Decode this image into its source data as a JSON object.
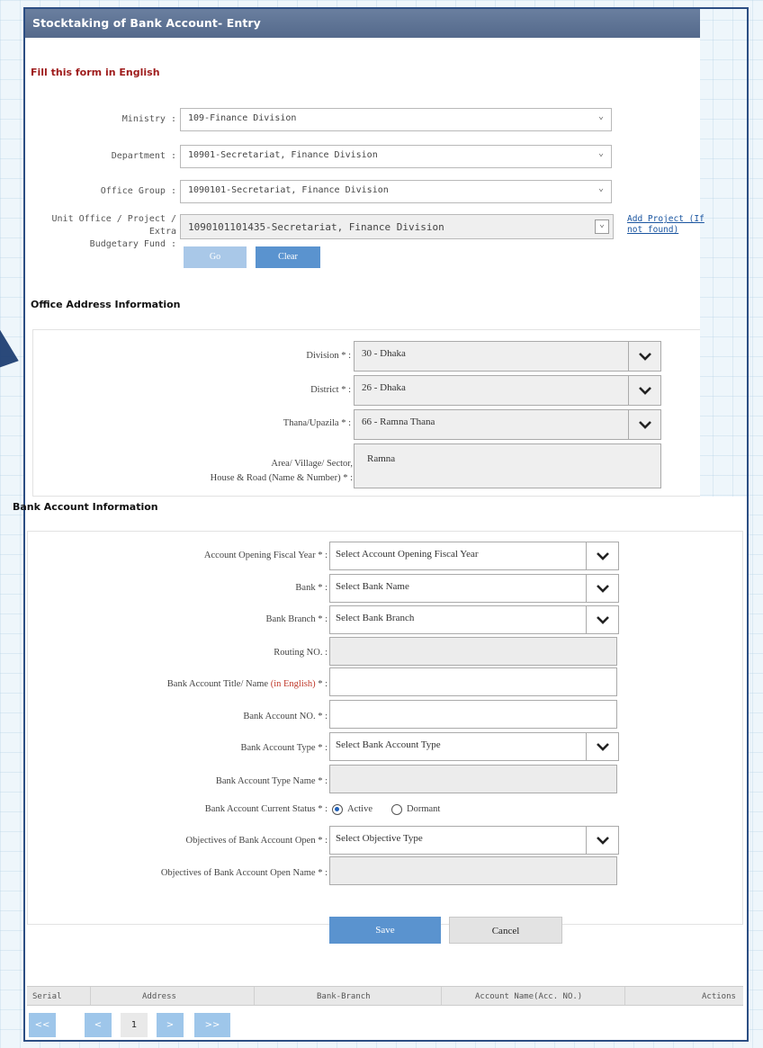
{
  "window": {
    "title": "Stocktaking of Bank Account- Entry",
    "fill_note": "Fill this form in English"
  },
  "office_search": {
    "ministry": {
      "label": "Ministry :",
      "value": "109-Finance Division"
    },
    "department": {
      "label": "Department :",
      "value": "10901-Secretariat, Finance Division"
    },
    "office_group": {
      "label": "Office Group :",
      "value": "1090101-Secretariat, Finance Division"
    },
    "unit_office": {
      "label_line1": "Unit Office / Project / Extra",
      "label_line2": "Budgetary Fund :",
      "value": "1090101101435-Secretariat, Finance Division"
    },
    "add_project_line1": "Add Project (If",
    "add_project_line2": "not found)",
    "go_label": "Go",
    "clear_label": "Clear"
  },
  "office_address": {
    "heading": "Office Address Information",
    "division": {
      "label": "Division * :",
      "value": "30 - Dhaka"
    },
    "district": {
      "label": "District * :",
      "value": "26 - Dhaka"
    },
    "thana": {
      "label": "Thana/Upazila * :",
      "value": "66 - Ramna Thana"
    },
    "area": {
      "label_line1": "Area/ Village/ Sector,",
      "label_line2": "House & Road (Name & Number) * :",
      "value": "Ramna"
    }
  },
  "bank_account": {
    "heading": "Bank Account Information",
    "fiscal_year": {
      "label": "Account Opening Fiscal Year * :",
      "value": "Select Account Opening Fiscal Year"
    },
    "bank": {
      "label": "Bank * :",
      "value": "Select Bank Name"
    },
    "branch": {
      "label": "Bank Branch * :",
      "value": "Select Bank Branch"
    },
    "routing": {
      "label": "Routing NO. :",
      "value": ""
    },
    "title": {
      "label": "Bank Account Title/ Name",
      "label_red": "(in English)",
      "label_tail": " * :",
      "value": ""
    },
    "number": {
      "label": "Bank Account NO. * :",
      "value": ""
    },
    "type": {
      "label": "Bank Account Type * :",
      "value": "Select Bank Account Type"
    },
    "type_name": {
      "label": "Bank Account Type Name * :",
      "value": ""
    },
    "status": {
      "label": "Bank Account Current Status * :",
      "options": [
        "Active",
        "Dormant"
      ],
      "selected": "Active"
    },
    "objective": {
      "label": "Objectives of Bank Account Open * :",
      "value": "Select Objective Type"
    },
    "objective_name": {
      "label": "Objectives of Bank Account Open Name * :",
      "value": ""
    }
  },
  "actions": {
    "save_label": "Save",
    "cancel_label": "Cancel"
  },
  "table": {
    "columns": [
      "Serial",
      "Address",
      "Bank-Branch",
      "Account Name(Acc. NO.)",
      "Actions"
    ]
  },
  "pagination": {
    "first": "<<",
    "prev": "<",
    "current": "1",
    "next": ">",
    "last": ">>"
  },
  "colors": {
    "title_bar": "#5f7595",
    "primary_button": "#5a93cf",
    "note_red": "#9e1b1b"
  }
}
